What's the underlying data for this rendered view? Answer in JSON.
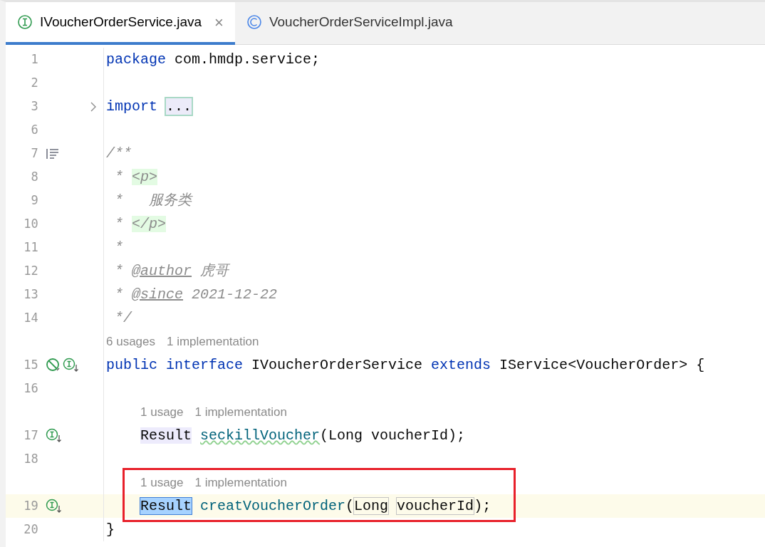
{
  "tabs": [
    {
      "label": "IVoucherOrderService.java",
      "kind": "interface",
      "selected": true,
      "close": "×"
    },
    {
      "label": "VoucherOrderServiceImpl.java",
      "kind": "class",
      "selected": false
    }
  ],
  "editor": {
    "rows": [
      {
        "kind": "code",
        "number": "1",
        "tokens": [
          {
            "kind": "keyword",
            "text": "package"
          },
          {
            "kind": "plain",
            "spaced": true,
            "text": "com.hmdp.service;"
          }
        ]
      },
      {
        "kind": "code",
        "number": "2",
        "tokens": []
      },
      {
        "kind": "code",
        "number": "3",
        "foldable": true,
        "tokens": [
          {
            "kind": "keyword",
            "text": "import"
          },
          {
            "kind": "fold",
            "spaced": true,
            "text": "..."
          }
        ]
      },
      {
        "kind": "code",
        "number": "6",
        "tokens": []
      },
      {
        "kind": "code",
        "number": "7",
        "icons": [
          {
            "kind": "doc"
          }
        ],
        "tokens": [
          {
            "kind": "comment",
            "text": "/**"
          }
        ]
      },
      {
        "kind": "code",
        "number": "8",
        "tokens": [
          {
            "kind": "comment",
            "text": " *"
          },
          {
            "kind": "html",
            "spaced": true,
            "text": "<p>"
          }
        ]
      },
      {
        "kind": "code",
        "number": "9",
        "tokens": [
          {
            "kind": "comment",
            "text": " *   服务类"
          }
        ]
      },
      {
        "kind": "code",
        "number": "10",
        "tokens": [
          {
            "kind": "comment",
            "text": " *"
          },
          {
            "kind": "html",
            "spaced": true,
            "text": "</p>"
          }
        ]
      },
      {
        "kind": "code",
        "number": "11",
        "tokens": [
          {
            "kind": "comment",
            "text": " *"
          }
        ]
      },
      {
        "kind": "code",
        "number": "12",
        "tokens": [
          {
            "kind": "comment",
            "text": " *"
          },
          {
            "kind": "doctag",
            "spaced": true,
            "text": "@author"
          },
          {
            "kind": "comment",
            "spaced": true,
            "text": "虎哥"
          }
        ]
      },
      {
        "kind": "code",
        "number": "13",
        "tokens": [
          {
            "kind": "comment",
            "text": " *"
          },
          {
            "kind": "doctag",
            "spaced": true,
            "text": "@since"
          },
          {
            "kind": "comment",
            "spaced": true,
            "text": "2021-12-22"
          }
        ]
      },
      {
        "kind": "code",
        "number": "14",
        "tokens": [
          {
            "kind": "comment",
            "text": " */"
          }
        ]
      },
      {
        "kind": "hint",
        "hints": [
          "6 usages",
          "1 implementation"
        ]
      },
      {
        "kind": "code",
        "number": "15",
        "icons": [
          {
            "kind": "blocked"
          },
          {
            "kind": "impl"
          }
        ],
        "tokens": [
          {
            "kind": "keyword",
            "text": "public"
          },
          {
            "kind": "keyword",
            "spaced": true,
            "text": "interface"
          },
          {
            "kind": "plain",
            "spaced": true,
            "text": "IVoucherOrderService"
          },
          {
            "kind": "keyword",
            "spaced": true,
            "text": "extends"
          },
          {
            "kind": "plain",
            "spaced": true,
            "text": "IService<VoucherOrder> {"
          }
        ]
      },
      {
        "kind": "code",
        "number": "16",
        "tokens": []
      },
      {
        "kind": "member-hint",
        "hints": [
          "1 usage",
          "1 implementation"
        ]
      },
      {
        "kind": "member",
        "number": "17",
        "icons": [
          {
            "kind": "impl"
          }
        ],
        "tokens": [
          {
            "kind": "ref",
            "text": "Result"
          },
          {
            "kind": "warn",
            "spaced": true,
            "text": "seckillVoucher"
          },
          {
            "kind": "plain",
            "text": "(Long voucherId);"
          }
        ]
      },
      {
        "kind": "code",
        "number": "18",
        "tokens": []
      },
      {
        "kind": "member-hint",
        "framed": true,
        "hints": [
          "1 usage",
          "1 implementation"
        ]
      },
      {
        "kind": "member",
        "number": "19",
        "framed": true,
        "current": true,
        "icons": [
          {
            "kind": "impl"
          }
        ],
        "tokens": [
          {
            "kind": "selected",
            "text": "Result"
          },
          {
            "kind": "method",
            "spaced": true,
            "text": "creatVoucherOrder"
          },
          {
            "kind": "plain",
            "text": "("
          },
          {
            "kind": "param",
            "text": "Long"
          },
          {
            "kind": "param",
            "spaced": true,
            "text": "voucherId"
          },
          {
            "kind": "plain",
            "text": ");"
          }
        ]
      },
      {
        "kind": "code",
        "number": "20",
        "tokens": [
          {
            "kind": "plain",
            "text": "}"
          }
        ]
      }
    ]
  }
}
